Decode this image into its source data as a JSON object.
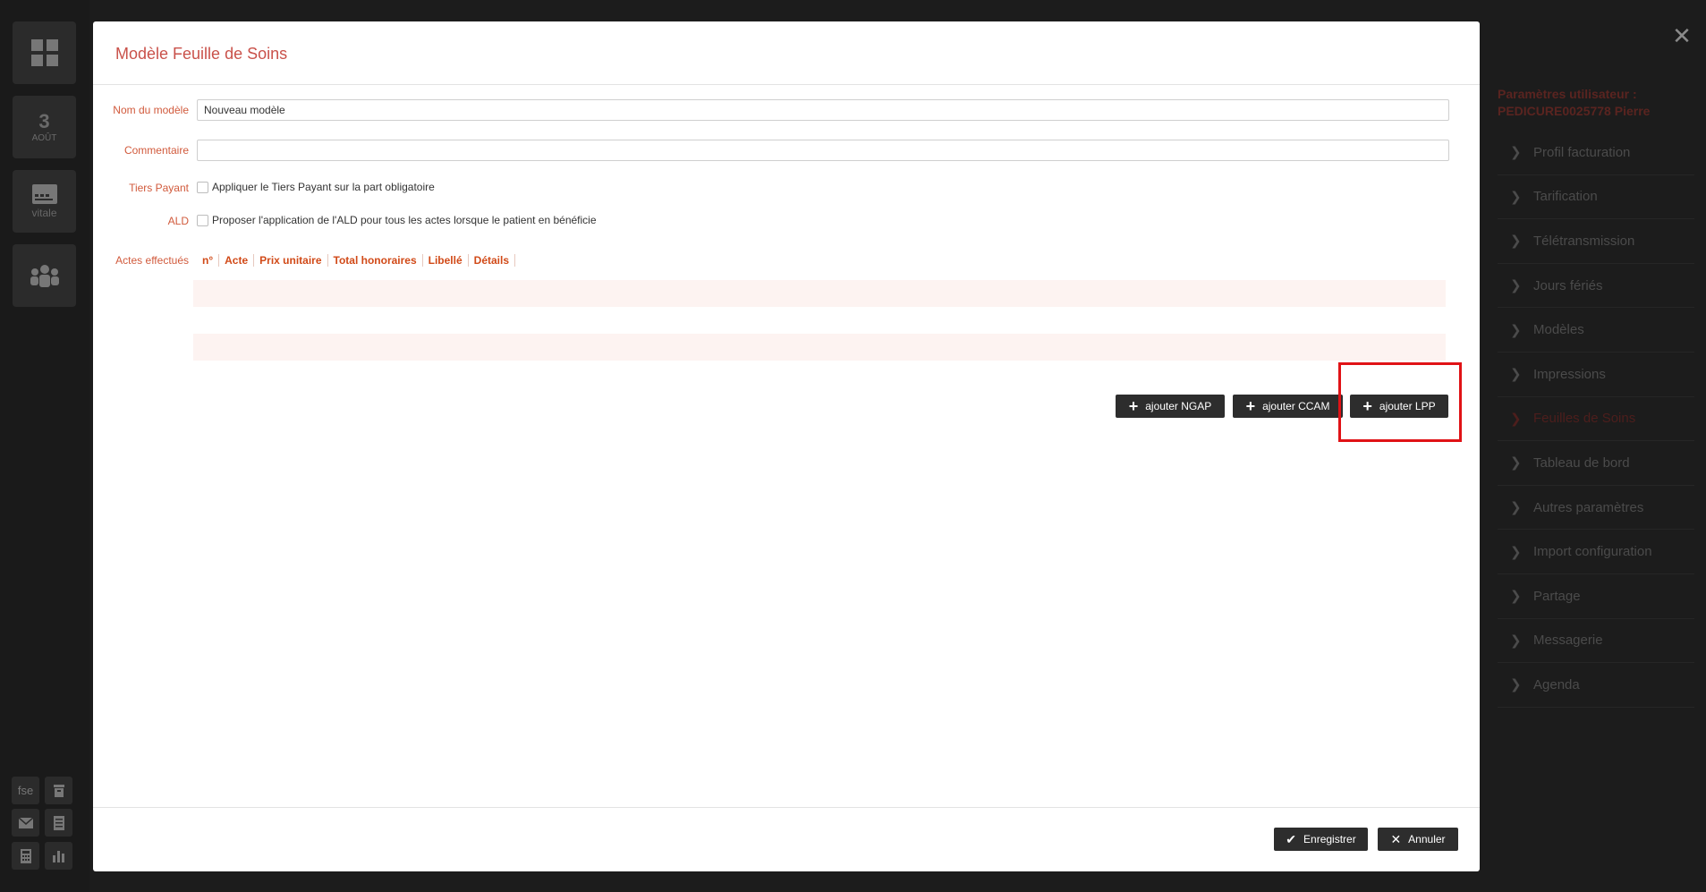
{
  "left_rail": {
    "date_day": "3",
    "date_month": "AOÛT",
    "vitale_label": "vitale",
    "fse_label": "fse"
  },
  "right_panel": {
    "title": "Paramètres utilisateur : PEDICURE0025778 Pierre",
    "items": [
      {
        "label": "Profil facturation",
        "active": false
      },
      {
        "label": "Tarification",
        "active": false
      },
      {
        "label": "Télétransmission",
        "active": false
      },
      {
        "label": "Jours fériés",
        "active": false
      },
      {
        "label": "Modèles",
        "active": false
      },
      {
        "label": "Impressions",
        "active": false
      },
      {
        "label": "Feuilles de Soins",
        "active": true
      },
      {
        "label": "Tableau de bord",
        "active": false
      },
      {
        "label": "Autres paramètres",
        "active": false
      },
      {
        "label": "Import configuration",
        "active": false
      },
      {
        "label": "Partage",
        "active": false
      },
      {
        "label": "Messagerie",
        "active": false
      },
      {
        "label": "Agenda",
        "active": false
      }
    ]
  },
  "modal": {
    "title": "Modèle Feuille de Soins",
    "fields": {
      "name_label": "Nom du modèle",
      "name_value": "Nouveau modèle",
      "comment_label": "Commentaire",
      "comment_value": "",
      "tiers_label": "Tiers Payant",
      "tiers_text": "Appliquer le Tiers Payant sur la part obligatoire",
      "ald_label": "ALD",
      "ald_text": "Proposer l'application de l'ALD pour tous les actes lorsque le patient en bénéficie",
      "actes_label": "Actes effectués"
    },
    "columns": [
      "n°",
      "Acte",
      "Prix unitaire",
      "Total honoraires",
      "Libellé",
      "Détails"
    ],
    "buttons": {
      "ngap": "ajouter NGAP",
      "ccam": "ajouter CCAM",
      "lpp": "ajouter LPP",
      "save": "Enregistrer",
      "cancel": "Annuler"
    }
  },
  "colors": {
    "accent": "#d14a18",
    "label": "#d15a3c",
    "highlight": "#e01216",
    "button": "#2d2d2d"
  }
}
